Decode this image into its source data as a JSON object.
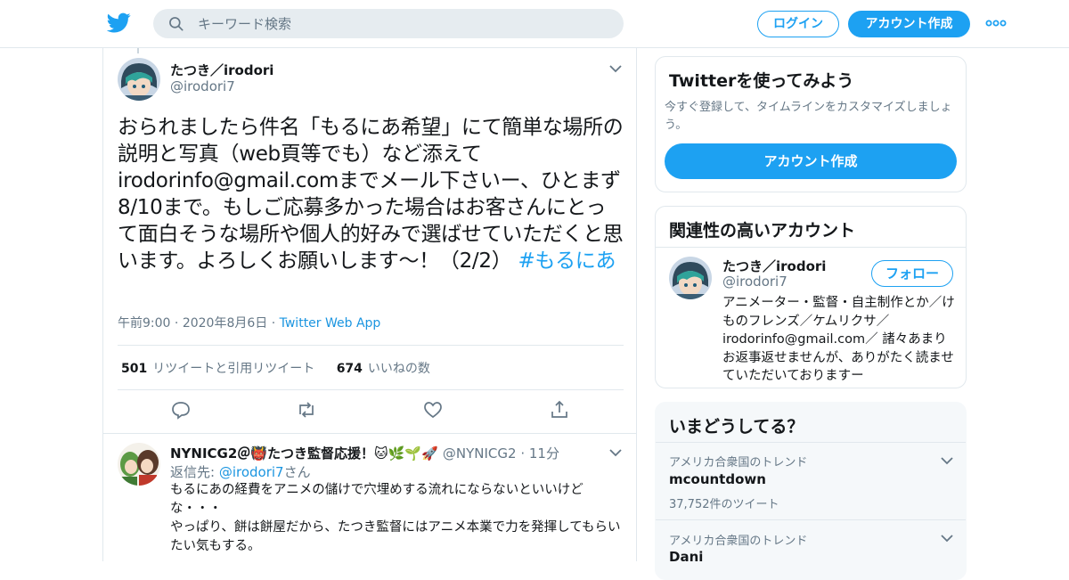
{
  "colors": {
    "accent": "#1da1f2",
    "link": "#1b95e0",
    "muted": "#657786",
    "border": "#e1e8ed"
  },
  "header": {
    "logo_icon": "twitter-bird-icon",
    "search_placeholder": "キーワード検索",
    "login_label": "ログイン",
    "signup_label": "アカウント作成",
    "more_icon": "more-dots-icon"
  },
  "tweet": {
    "author_name": "たつき／irodori",
    "author_handle": "@irodori7",
    "text_before_hashtag": "おられましたら件名「もるにあ希望」にて簡単な場所の説明と写真（web頁等でも）など添えてirodorinfo@gmail.comまでメール下さいー、ひとまず8/10まで。もしご応募多かった場合はお客さんにとって面白そうな場所や個人的好みで選ばせていただくと思います。よろしくお願いします〜！（2/2）",
    "hashtag": "#もるにあ",
    "time": "午前9:00",
    "date": "2020年8月6日",
    "via": "Twitter Web App",
    "retweet_count": "501",
    "retweet_label": "リツイートと引用リツイート",
    "like_count": "674",
    "like_label": "いいねの数"
  },
  "reply": {
    "name": "NYNICG2＠👹たつき監督応援！🐱🌿🌱🚀",
    "handle": "@NYNICG2",
    "time": "11分",
    "reply_to_label": "返信先:",
    "reply_to_handle": "@irodori7",
    "reply_to_suffix": "さん",
    "line1": "もるにあの経費をアニメの儲けで穴埋めする流れにならないといいけどな・・・",
    "line2": "やっぱり、餅は餅屋だから、たつき監督にはアニメ本業で力を発揮してもらいたい気もする。"
  },
  "sidebar": {
    "try_title": "Twitterを使ってみよう",
    "try_sub": "今すぐ登録して、タイムラインをカスタマイズしましょう。",
    "try_button": "アカウント作成",
    "related_title": "関連性の高いアカウント",
    "related_name": "たつき／irodori",
    "related_handle": "@irodori7",
    "follow_label": "フォロー",
    "related_bio": "アニメーター・監督・自主制作とか／けものフレンズ／ケムリクサ／irodorinfo@gmail.com／ 諸々あまりお返事返せませんが、ありがたく読ませていただいておりますー",
    "trends_title": "いまどうしてる？",
    "trends": [
      {
        "location": "アメリカ合衆国のトレンド",
        "name": "mcountdown",
        "count": "37,752件のツイート"
      },
      {
        "location": "アメリカ合衆国のトレンド",
        "name": "Dani",
        "count": ""
      }
    ]
  }
}
